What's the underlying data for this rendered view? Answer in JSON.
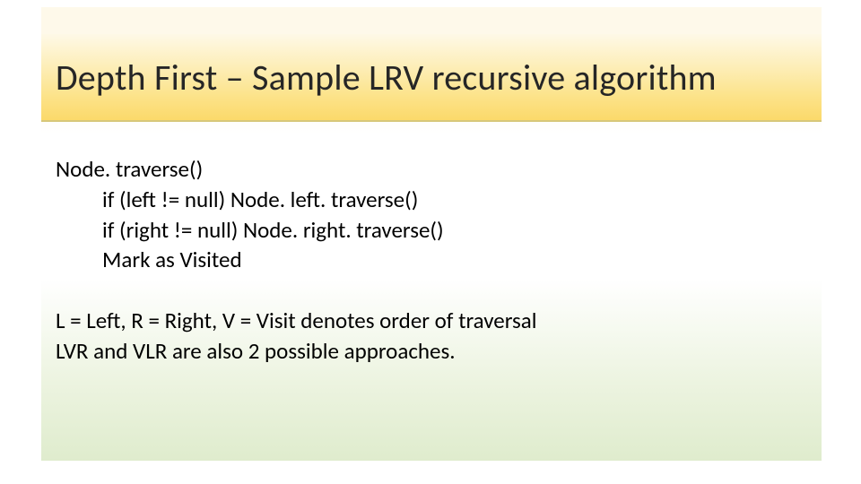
{
  "title": "Depth First – Sample LRV recursive algorithm",
  "code": {
    "line1": "Node. traverse()",
    "line2": "if (left != null) Node. left. traverse()",
    "line3": "if (right != null) Node. right. traverse()",
    "line4": "Mark as Visited"
  },
  "notes": {
    "line1": "L = Left, R = Right, V = Visit denotes order of traversal",
    "line2": "LVR and VLR are also 2 possible approaches."
  }
}
